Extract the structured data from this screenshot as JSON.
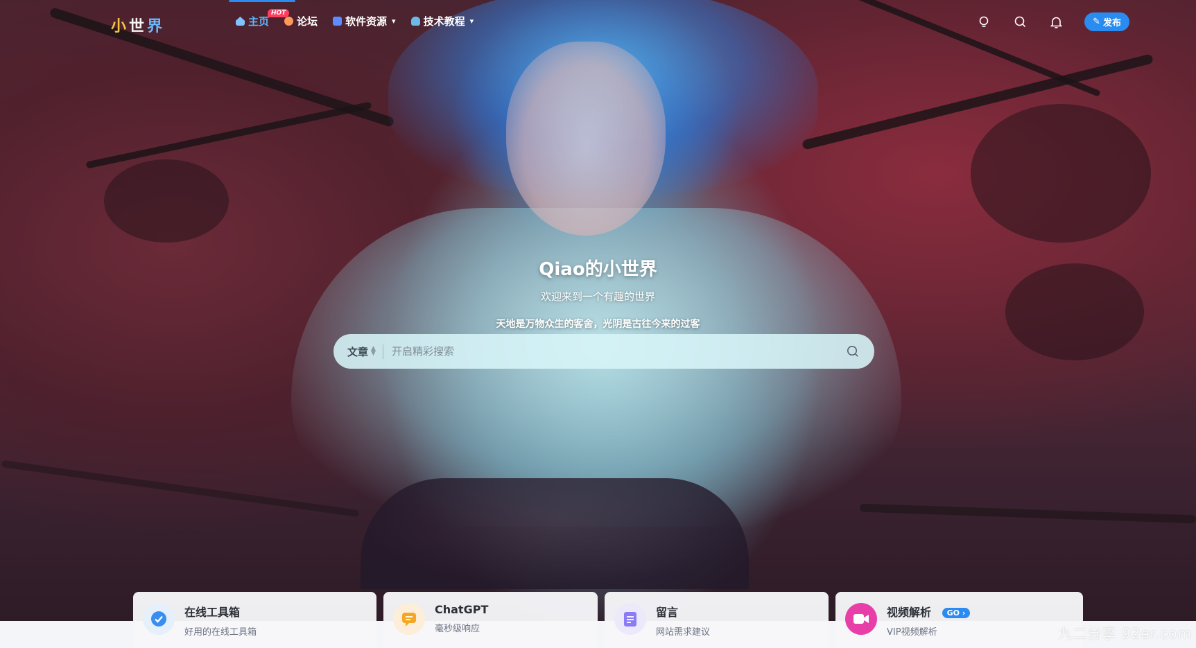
{
  "site": {
    "logo_text_1": "小",
    "logo_text_2": "世",
    "logo_text_3": "界"
  },
  "nav": {
    "items": [
      {
        "label": "主页",
        "icon": "home-icon",
        "active": true,
        "badge": "HOT"
      },
      {
        "label": "论坛",
        "icon": "forum-icon",
        "active": false
      },
      {
        "label": "软件资源",
        "icon": "software-icon",
        "active": false,
        "dropdown": true
      },
      {
        "label": "技术教程",
        "icon": "tutorial-icon",
        "active": false,
        "dropdown": true
      }
    ],
    "chevron": "⌄",
    "publish_label": "发布",
    "accent_color": "#2a8cf0"
  },
  "hero": {
    "title": "Qiao的小世界",
    "subtitle": "欢迎来到一个有趣的世界",
    "quote": "天地是万物众生的客舍，光阴是古往今来的过客"
  },
  "search": {
    "type_label": "文章",
    "placeholder": "开启精彩搜索"
  },
  "cards": [
    {
      "title": "在线工具箱",
      "desc": "好用的在线工具箱",
      "icon": "check-badge-icon",
      "color": "#3a8ef0"
    },
    {
      "title": "ChatGPT",
      "desc": "毫秒级响应",
      "icon": "chat-icon",
      "color": "#f5a623"
    },
    {
      "title": "留言",
      "desc": "网站需求建议",
      "icon": "note-icon",
      "color": "#8b7cf6"
    },
    {
      "title": "视频解析",
      "desc": "VIP视频解析",
      "icon": "video-camera-icon",
      "color": "#e83ea8",
      "badge": "GO"
    }
  ],
  "watermark": "九二分享 92er.com"
}
